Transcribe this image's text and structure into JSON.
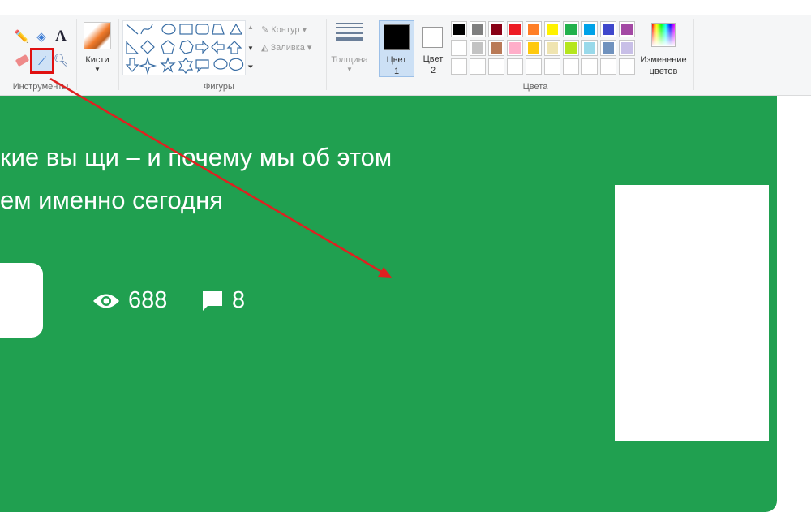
{
  "ribbon": {
    "tools_label": "Инструменты",
    "brushes_label": "Кисти",
    "shapes_label": "Фигуры",
    "outline_label": "Контур",
    "fill_label": "Заливка",
    "size_label": "Толщина",
    "color1_label": "Цвет",
    "color1_num": "1",
    "color2_label": "Цвет",
    "color2_num": "2",
    "colors_label": "Цвета",
    "edit_colors_line1": "Изменение",
    "edit_colors_line2": "цветов",
    "palette_row1": [
      "#000000",
      "#7f7f7f",
      "#880015",
      "#ed1c24",
      "#ff7f27",
      "#fff200",
      "#22b14c",
      "#00a2e8",
      "#3f48cc",
      "#a349a4"
    ],
    "palette_row2": [
      "#ffffff",
      "#c3c3c3",
      "#b97a57",
      "#ffaec9",
      "#ffc90e",
      "#efe4b0",
      "#b5e61d",
      "#99d9ea",
      "#7092be",
      "#c8bfe7"
    ],
    "color1": "#000000",
    "color2": "#ffffff"
  },
  "canvas": {
    "headline_line1": "кие вы щи – и почему мы об этом",
    "headline_line2": "ем именно сегодня",
    "views": "688",
    "comments": "8",
    "bg_color": "#20a050",
    "annotation_color": "#e02020"
  }
}
